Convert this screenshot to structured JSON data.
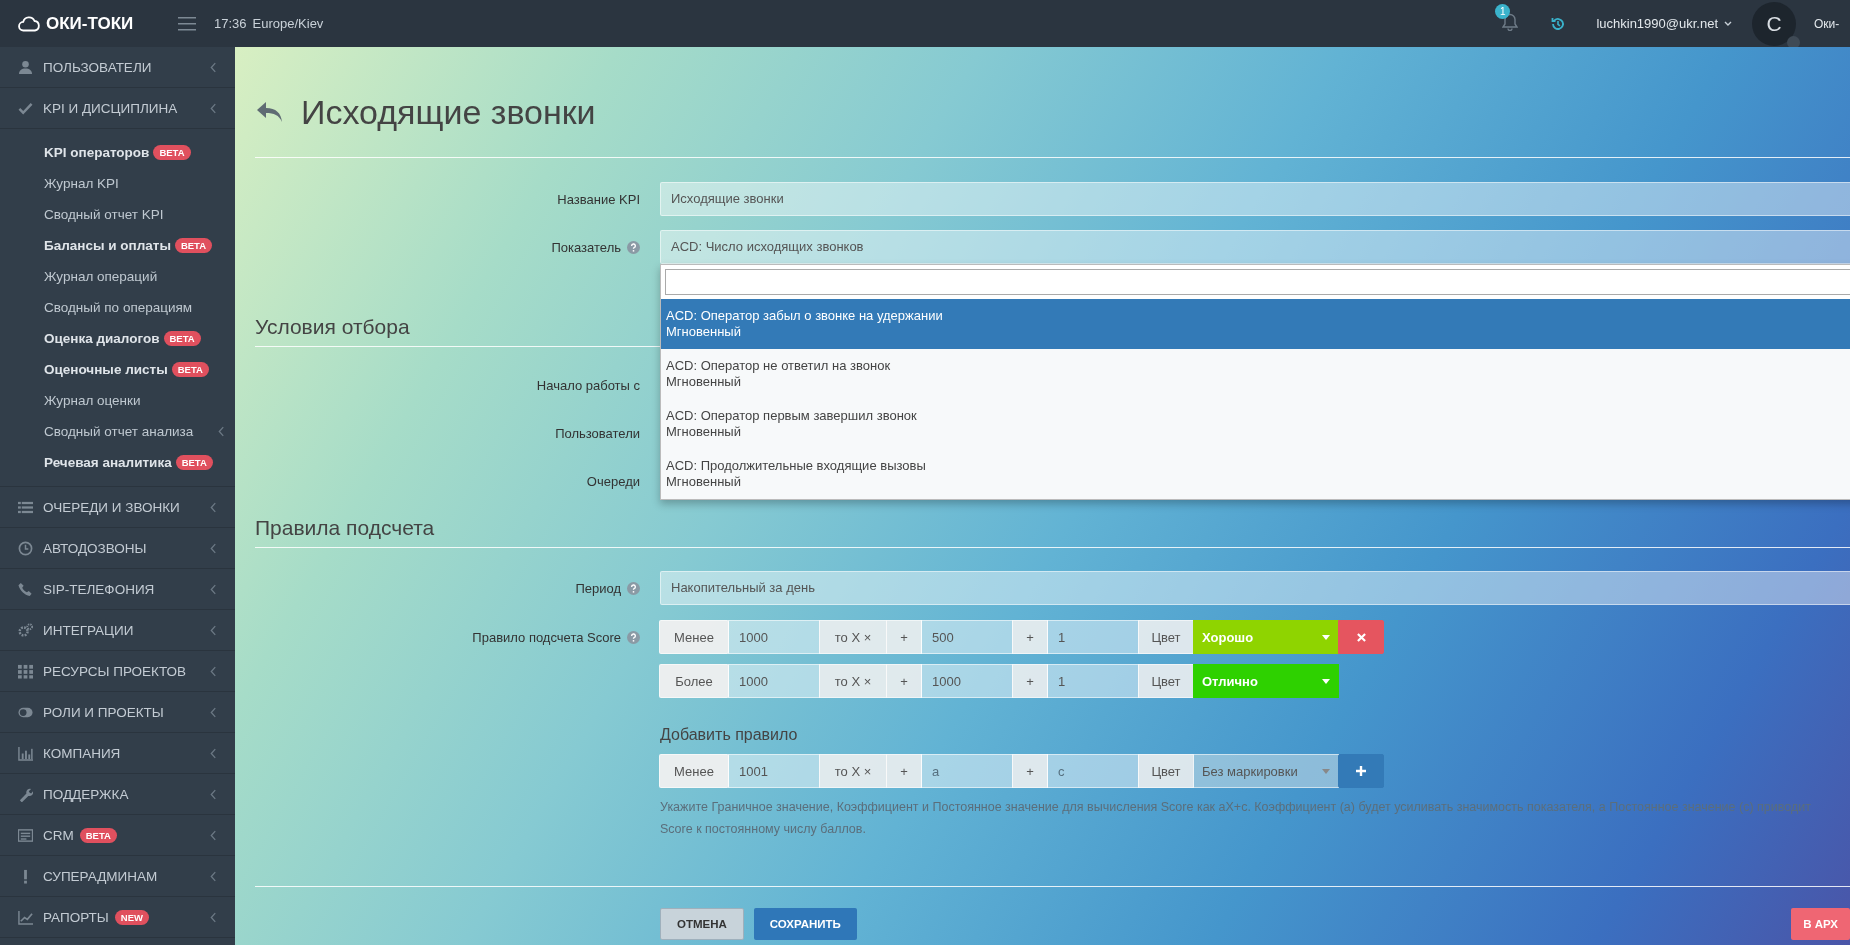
{
  "topbar": {
    "logo": "ОКИ-ТОКИ",
    "time": "17:36",
    "timezone": "Europe/Kiev",
    "notification_count": "1",
    "user_email": "luchkin1990@ukr.net",
    "avatar_letter": "С",
    "company": "Оки-"
  },
  "sidebar": {
    "items": [
      {
        "label": "ПОЛЬЗОВАТЕЛИ"
      },
      {
        "label": "KPI И ДИСЦИПЛИНА",
        "children": [
          {
            "label": "KPI операторов",
            "emphasized": true,
            "badge": "BETA",
            "submenu": false
          },
          {
            "label": "Журнал KPI",
            "emphasized": false,
            "submenu": false
          },
          {
            "label": "Сводный отчет KPI",
            "emphasized": false,
            "submenu": false
          },
          {
            "label": "Балансы и оплаты",
            "emphasized": true,
            "badge": "BETA",
            "submenu": false
          },
          {
            "label": "Журнал операций",
            "emphasized": false,
            "submenu": false
          },
          {
            "label": "Сводный по операциям",
            "emphasized": false,
            "submenu": false
          },
          {
            "label": "Оценка диалогов",
            "emphasized": true,
            "badge": "BETA",
            "submenu": false
          },
          {
            "label": "Оценочные листы",
            "emphasized": true,
            "badge": "BETA",
            "submenu": false
          },
          {
            "label": "Журнал оценки",
            "emphasized": false,
            "submenu": false
          },
          {
            "label": "Сводный отчет анализа",
            "emphasized": false,
            "submenu": true
          },
          {
            "label": "Речевая аналитика",
            "emphasized": true,
            "badge": "BETA",
            "submenu": false
          }
        ]
      },
      {
        "label": "ОЧЕРЕДИ И ЗВОНКИ"
      },
      {
        "label": "АВТОДОЗВОНЫ"
      },
      {
        "label": "SIP-ТЕЛЕФОНИЯ"
      },
      {
        "label": "ИНТЕГРАЦИИ"
      },
      {
        "label": "РЕСУРСЫ ПРОЕКТОВ"
      },
      {
        "label": "РОЛИ И ПРОЕКТЫ"
      },
      {
        "label": "КОМПАНИЯ"
      },
      {
        "label": "ПОДДЕРЖКА"
      },
      {
        "label": "CRM",
        "badge": "BETA"
      },
      {
        "label": "СУПЕРАДМИНАМ"
      },
      {
        "label": "РАПОРТЫ",
        "badge": "NEW"
      }
    ]
  },
  "page": {
    "title": "Исходящие звонки"
  },
  "fields": [
    {
      "label": "Название KPI",
      "value": "Исходящие звонки",
      "help": false
    },
    {
      "label": "Показатель",
      "value": "ACD: Число исходящих звонков",
      "help": true
    }
  ],
  "dropdown": {
    "options": [
      {
        "title": "ACD: Оператор забыл о звонке на удержании",
        "subtitle": "Мгновенный",
        "selected": true
      },
      {
        "title": "ACD: Оператор не ответил на звонок",
        "subtitle": "Мгновенный",
        "selected": false
      },
      {
        "title": "ACD: Оператор первым завершил звонок",
        "subtitle": "Мгновенный",
        "selected": false
      },
      {
        "title": "ACD: Продолжительные входящие вызовы",
        "subtitle": "Мгновенный",
        "selected": false
      }
    ]
  },
  "selection": {
    "heading": "Условия отбора",
    "fields": [
      {
        "label": "Начало работы с"
      },
      {
        "label": "Пользователи"
      },
      {
        "label": "Очереди"
      }
    ]
  },
  "scoring": {
    "heading": "Правила подсчета",
    "period": {
      "label": "Период",
      "value": "Накопительный за день",
      "help": true
    },
    "rule_label": "Правило подсчета Score",
    "rule_help": true,
    "rules": [
      {
        "condition": "Менее",
        "boundary": "1000",
        "multiplier_label": "то X ×",
        "plus_a": "+",
        "a": "500",
        "plus_c": "+",
        "c": "1",
        "color_label": "Цвет",
        "marking": "Хорошо",
        "color": "#8fd400",
        "removable": true
      },
      {
        "condition": "Более",
        "boundary": "1000",
        "multiplier_label": "то X ×",
        "plus_a": "+",
        "a": "1000",
        "plus_c": "+",
        "c": "1",
        "color_label": "Цвет",
        "marking": "Отлично",
        "color": "#2ed100",
        "removable": false
      }
    ],
    "add_rule": {
      "heading": "Добавить правило",
      "condition": "Менее",
      "boundary": "1001",
      "multiplier_label": "то X ×",
      "plus_a": "+",
      "a_placeholder": "a",
      "plus_c": "+",
      "c_placeholder": "c",
      "color_label": "Цвет",
      "marking": "Без маркировки"
    },
    "help_text": "Укажите Граничное значение, Коэффициент и Постоянное значение для вычисления Score как aX+c. Коэффициент (a) будет усиливать значимость показателя, а Постоянное значение (c) приводит Score к постоянному числу баллов."
  },
  "actions": {
    "cancel": "ОТМЕНА",
    "save": "СОХРАНИТЬ",
    "archive": "В АРХ"
  }
}
